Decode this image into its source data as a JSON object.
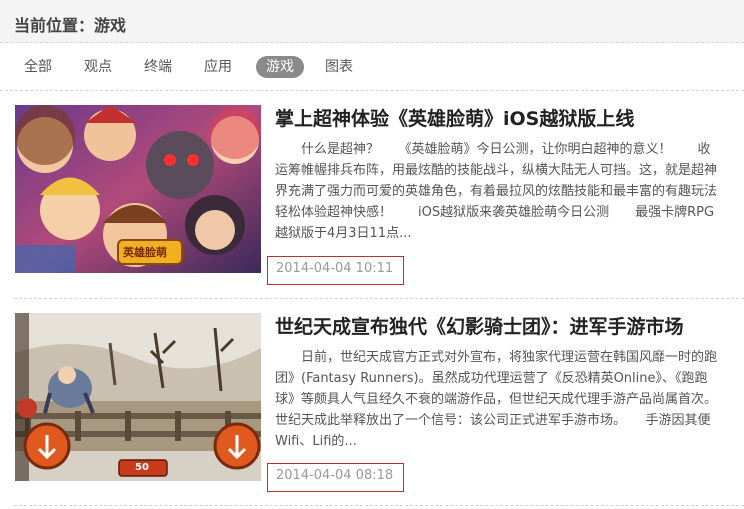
{
  "breadcrumb": "当前位置：游戏",
  "tabs": [
    {
      "label": "全部"
    },
    {
      "label": "观点"
    },
    {
      "label": "终端"
    },
    {
      "label": "应用"
    },
    {
      "label": "游戏"
    },
    {
      "label": "图表"
    }
  ],
  "active_tab": "游戏",
  "articles": [
    {
      "title": "掌上超神体验《英雄脸萌》iOS越狱版上线",
      "summary_lines": [
        "　　什么是超神？　　《英雄脸萌》今日公测，让你明白超神的意义！　　收",
        "运筹帷幄排兵布阵，用最炫酷的技能战斗，纵横大陆无人可挡。这，就是超神",
        "界充满了强力而可爱的英雄角色，有着最拉风的炫酷技能和最丰富的有趣玩法",
        "轻松体验超神快感！　　iOS越狱版来袭英雄脸萌今日公测　　最强卡牌RPG",
        "越狱版于4月3日11点..."
      ],
      "date": "2014-04-04 10:11",
      "image_caption": "英雄脸萌"
    },
    {
      "title": "世纪天成宣布独代《幻影骑士团》：进军手游市场",
      "summary_lines": [
        "　　日前，世纪天成官方正式对外宣布，将独家代理运营在韩国风靡一时的跑",
        "团》(Fantasy Runners)。虽然成功代理运营了《反恐精英Online》、《跑跑",
        "球》等颇具人气且经久不衰的端游作品，但世纪天成代理手游产品尚属首次。",
        "世纪天成此举释放出了一个信号：该公司正式进军手游市场。　　手游因其便",
        "Wifi、Lifi的..."
      ],
      "date": "2014-04-04 08:18",
      "image_counter": "50"
    }
  ],
  "colors": {
    "header_bg": "#f4f4f4",
    "active_tab_bg": "#8a8a8a",
    "date_box_border": "#c0302a",
    "date_text": "#999999"
  }
}
